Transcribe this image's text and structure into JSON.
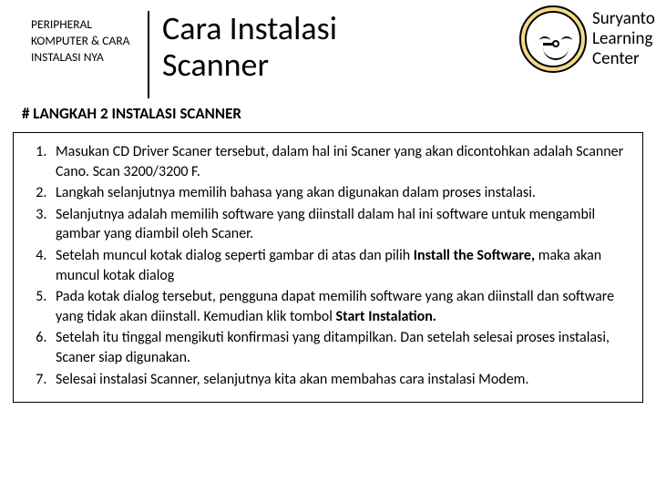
{
  "header": {
    "kicker": "PERIPHERAL KOMPUTER & CARA INSTALASI NYA",
    "title_line1": "Cara Instalasi",
    "title_line2": "Scanner"
  },
  "badge": {
    "text": "Suryanto Learning Center"
  },
  "subheading": "# LANGKAH 2 INSTALASI SCANNER",
  "steps": [
    {
      "pre": "Masukan CD Driver Scaner tersebut, dalam hal ini Scaner yang akan dicontohkan adalah Scanner Cano. Scan 3200/3200 F.",
      "bold": "",
      "post": ""
    },
    {
      "pre": "Langkah selanjutnya memilih bahasa yang akan digunakan dalam proses instalasi.",
      "bold": "",
      "post": ""
    },
    {
      "pre": "Selanjutnya adalah memilih software yang diinstall dalam hal ini software untuk mengambil gambar yang diambil oleh Scaner.",
      "bold": "",
      "post": ""
    },
    {
      "pre": "Setelah muncul kotak dialog seperti gambar di atas dan pilih ",
      "bold": "Install the Software, ",
      "post": "maka akan muncul kotak dialog"
    },
    {
      "pre": "Pada kotak dialog tersebut, pengguna dapat memilih software yang akan diinstall dan software yang tidak akan diinstall. Kemudian klik tombol ",
      "bold": "Start Instalation.",
      "post": ""
    },
    {
      "pre": "Setelah itu tinggal mengikuti konfirmasi yang ditampilkan. Dan setelah selesai proses instalasi, Scaner siap digunakan.",
      "bold": "",
      "post": ""
    },
    {
      "pre": "Selesai instalasi Scanner, selanjutnya kita akan membahas cara instalasi Modem.",
      "bold": "",
      "post": ""
    }
  ]
}
